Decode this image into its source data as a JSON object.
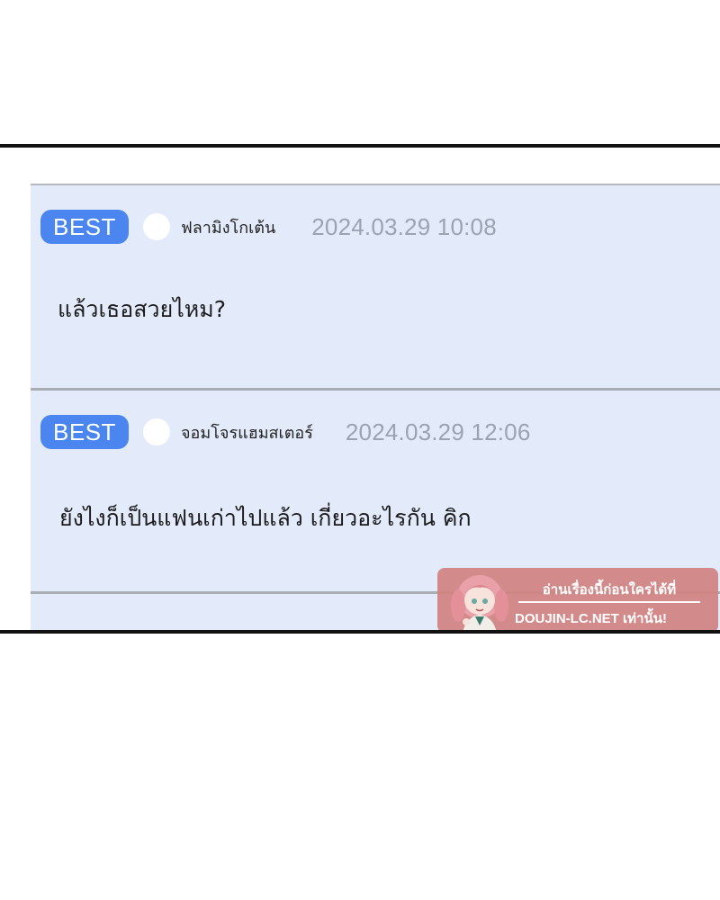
{
  "comments": [
    {
      "badge": "BEST",
      "username": "ฟลามิงโกเต้น",
      "timestamp": "2024.03.29 10:08",
      "text": "แล้วเธอสวยไหม?"
    },
    {
      "badge": "BEST",
      "username": "จอมโจรแฮมสเตอร์",
      "timestamp": "2024.03.29 12:06",
      "text": "ยังไงก็เป็นแฟนเก่าไปแล้ว เกี่ยวอะไรกัน คิก"
    }
  ],
  "watermark": {
    "line1": "อ่านเรื่องนี้ก่อนใครได้ที่",
    "line2": "DOUJIN-LC.NET เท่านั้น!",
    "background": "#d08280"
  },
  "colors": {
    "badge": "#4b86f0",
    "list_background": "#e3ebfb",
    "timestamp": "#9ba3b3",
    "divider": "#a9adb4"
  }
}
